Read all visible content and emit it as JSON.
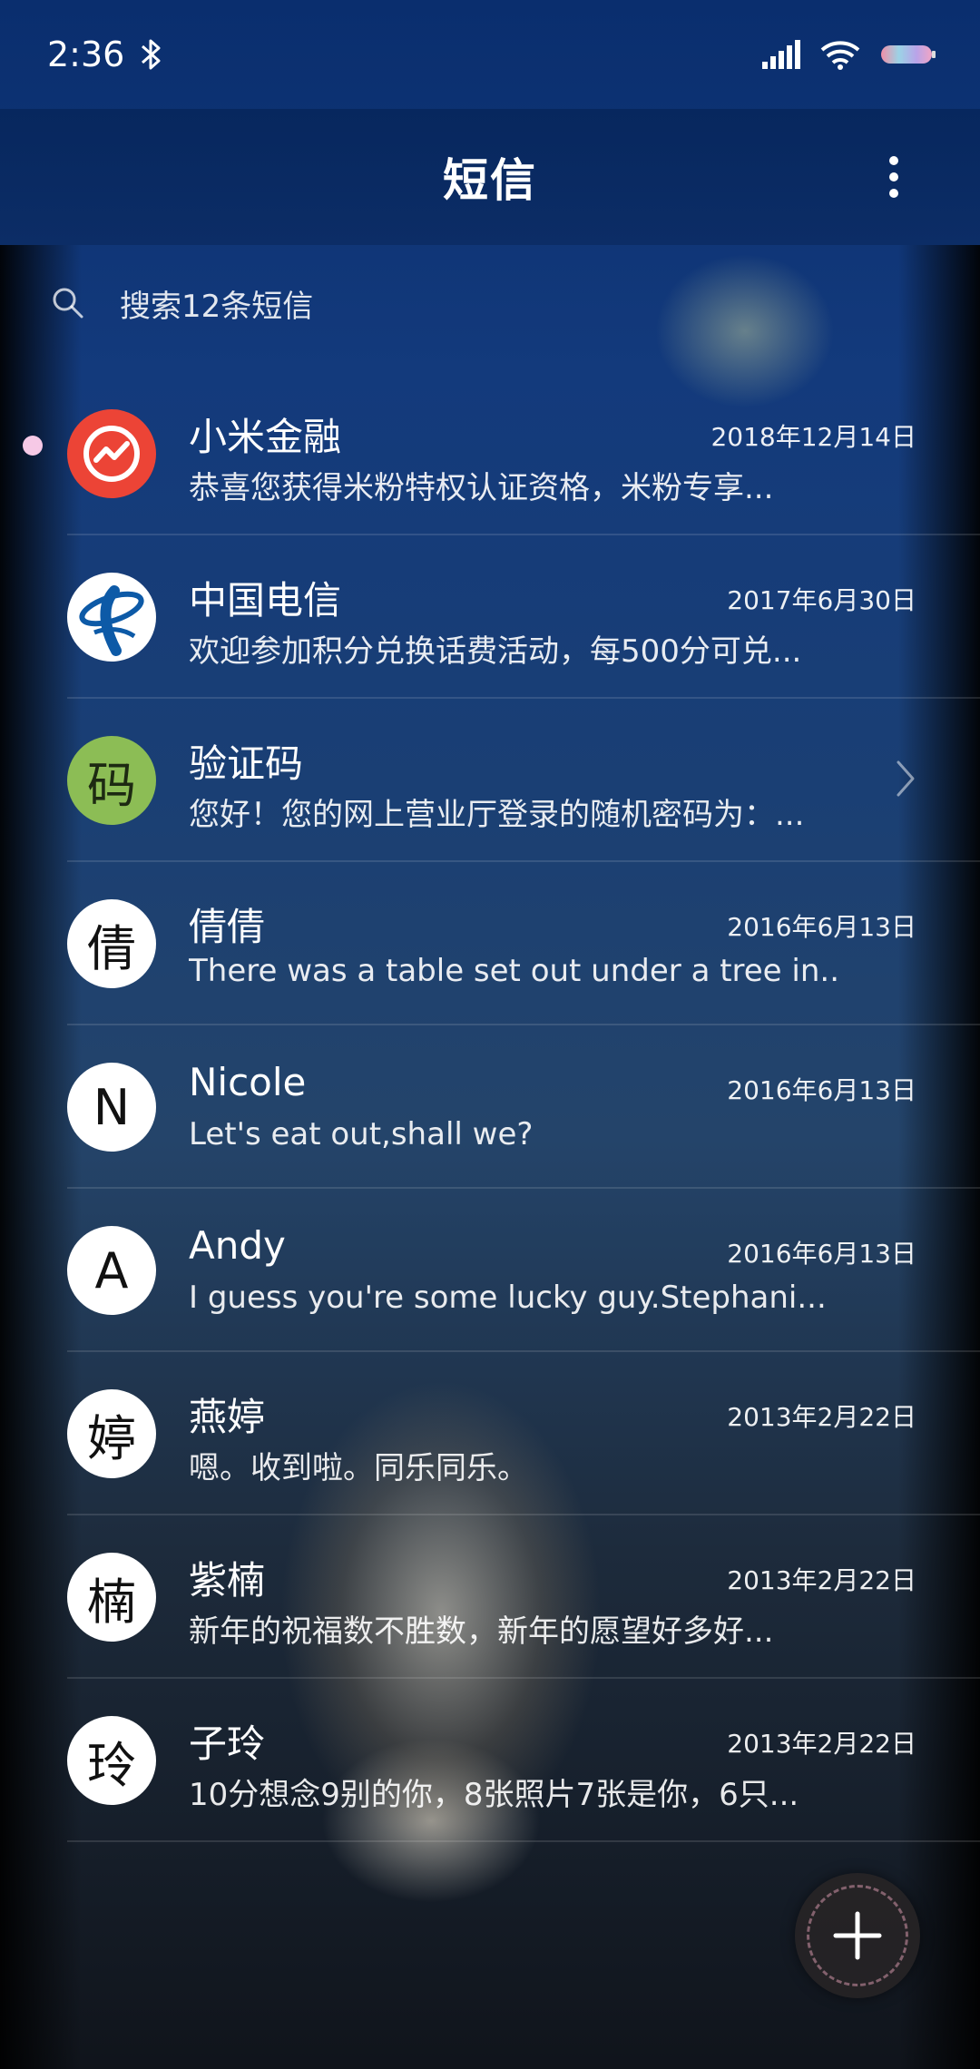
{
  "status_bar": {
    "time": "2:36"
  },
  "header": {
    "title": "短信"
  },
  "search": {
    "placeholder": "搜索12条短信"
  },
  "conversations": [
    {
      "name": "小米金融",
      "date": "2018年12月14日",
      "preview": "恭喜您获得米粉特权认证资格，米粉专享...",
      "avatar_type": "mi-finance-logo",
      "unread": true
    },
    {
      "name": "中国电信",
      "date": "2017年6月30日",
      "preview": "欢迎参加积分兑换话费活动，每500分可兑...",
      "avatar_type": "china-telecom-logo"
    },
    {
      "name": "验证码",
      "date": "",
      "preview": "您好！您的网上营业厅登录的随机密码为：...",
      "avatar_text": "码",
      "avatar_type": "code",
      "has_chevron": true
    },
    {
      "name": "倩倩",
      "date": "2016年6月13日",
      "preview": "There was a table set out under a tree in...",
      "avatar_text": "倩",
      "avatar_type": "letter"
    },
    {
      "name": "Nicole",
      "date": "2016年6月13日",
      "preview": "Let's eat out,shall we?",
      "avatar_text": "N",
      "avatar_type": "letter"
    },
    {
      "name": "Andy",
      "date": "2016年6月13日",
      "preview": "I guess you're some lucky guy.Stephani...",
      "avatar_text": "A",
      "avatar_type": "letter"
    },
    {
      "name": "燕婷",
      "date": "2013年2月22日",
      "preview": "嗯。收到啦。同乐同乐。",
      "avatar_text": "婷",
      "avatar_type": "letter"
    },
    {
      "name": "紫楠",
      "date": "2013年2月22日",
      "preview": "新年的祝福数不胜数，新年的愿望好多好...",
      "avatar_text": "楠",
      "avatar_type": "letter"
    },
    {
      "name": "子玲",
      "date": "2013年2月22日",
      "preview": "10分想念9别的你，8张照片7张是你，6只...",
      "avatar_text": "玲",
      "avatar_type": "letter"
    }
  ],
  "icons": {
    "bluetooth": "bluetooth-icon",
    "signal": "signal-icon",
    "wifi": "wifi-icon",
    "battery": "battery-icon",
    "more": "more-vertical-icon",
    "search": "search-icon",
    "compose": "plus-icon"
  },
  "colors": {
    "unread_dot": "#f6c9e6",
    "mi_finance": "#ec4436",
    "code_avatar": "#8cbd55",
    "telecom_blue": "#0d5aa7"
  }
}
